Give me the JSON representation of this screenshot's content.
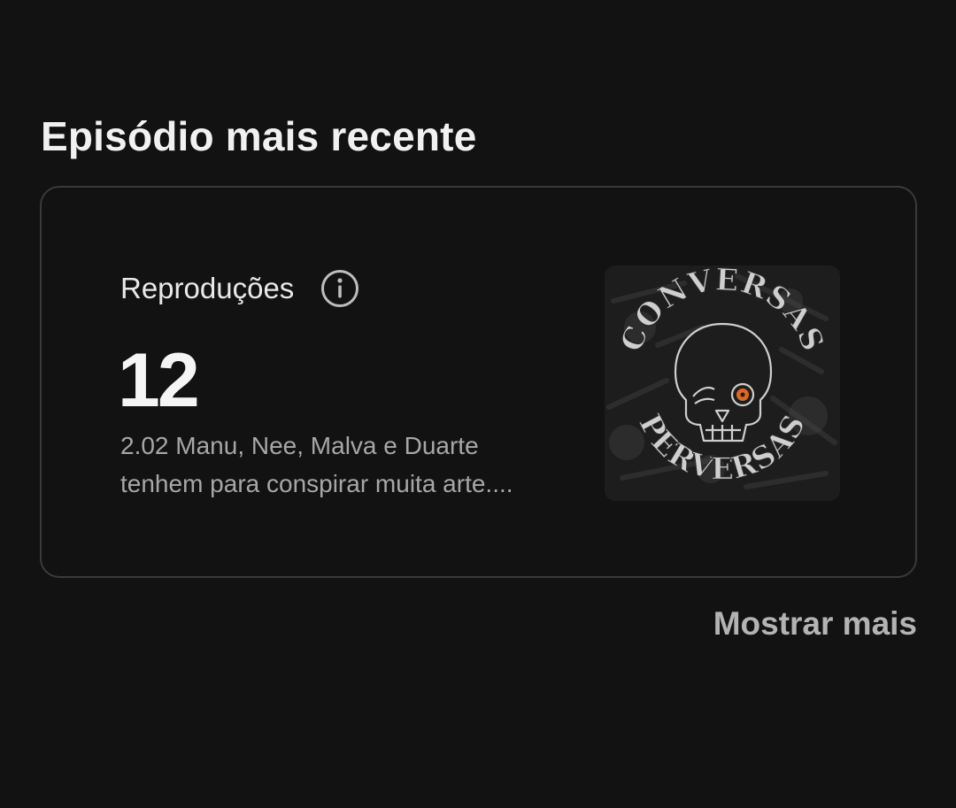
{
  "section": {
    "title": "Episódio mais recente"
  },
  "episode_card": {
    "stat_label": "Reproduções",
    "stat_value": "12",
    "description_line1": "2.02 Manu, Nee, Malva e Duarte",
    "description_line2": "tenhem para conspirar muita arte....",
    "info_icon": "info-circle-icon",
    "cover": {
      "top_text": "CONVERSAS",
      "bottom_text": "PERVERSAS",
      "accent_color": "#e0661f"
    }
  },
  "show_more_label": "Mostrar mais",
  "colors": {
    "background": "#121212",
    "card_border": "#3a3a3a",
    "muted_text": "#a7a7a7"
  }
}
